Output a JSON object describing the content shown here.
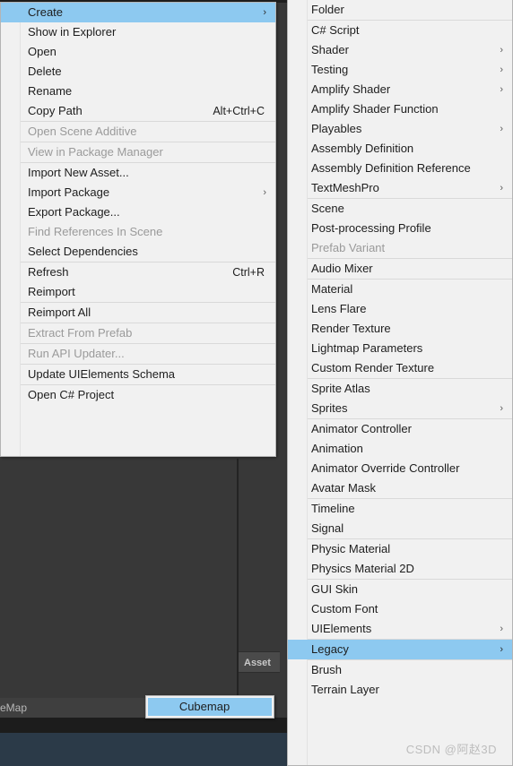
{
  "colors": {
    "menu_background": "#f1f1f1",
    "menu_border": "#b4b4b4",
    "highlight": "#8dc9f0",
    "text": "#1d1d1d",
    "text_disabled": "#9a9a9a",
    "separator": "#d9d9d9",
    "editor_dark": "#383838",
    "editor_darker": "#1c1c1c",
    "scene_blue": "#2b3a48"
  },
  "editor": {
    "project_row_label": "eMap",
    "inspector_asset_label": "Asset"
  },
  "context_menu": {
    "name": "asset-context-menu",
    "items": [
      {
        "label": "Create",
        "shortcut": "",
        "arrow": true,
        "disabled": false,
        "selected": true,
        "sep_after": false
      },
      {
        "label": "Show in Explorer",
        "shortcut": "",
        "arrow": false,
        "disabled": false,
        "selected": false,
        "sep_after": false
      },
      {
        "label": "Open",
        "shortcut": "",
        "arrow": false,
        "disabled": false,
        "selected": false,
        "sep_after": false
      },
      {
        "label": "Delete",
        "shortcut": "",
        "arrow": false,
        "disabled": false,
        "selected": false,
        "sep_after": false
      },
      {
        "label": "Rename",
        "shortcut": "",
        "arrow": false,
        "disabled": false,
        "selected": false,
        "sep_after": false
      },
      {
        "label": "Copy Path",
        "shortcut": "Alt+Ctrl+C",
        "arrow": false,
        "disabled": false,
        "selected": false,
        "sep_after": true
      },
      {
        "label": "Open Scene Additive",
        "shortcut": "",
        "arrow": false,
        "disabled": true,
        "selected": false,
        "sep_after": true
      },
      {
        "label": "View in Package Manager",
        "shortcut": "",
        "arrow": false,
        "disabled": true,
        "selected": false,
        "sep_after": true
      },
      {
        "label": "Import New Asset...",
        "shortcut": "",
        "arrow": false,
        "disabled": false,
        "selected": false,
        "sep_after": false
      },
      {
        "label": "Import Package",
        "shortcut": "",
        "arrow": true,
        "disabled": false,
        "selected": false,
        "sep_after": false
      },
      {
        "label": "Export Package...",
        "shortcut": "",
        "arrow": false,
        "disabled": false,
        "selected": false,
        "sep_after": false
      },
      {
        "label": "Find References In Scene",
        "shortcut": "",
        "arrow": false,
        "disabled": true,
        "selected": false,
        "sep_after": false
      },
      {
        "label": "Select Dependencies",
        "shortcut": "",
        "arrow": false,
        "disabled": false,
        "selected": false,
        "sep_after": true
      },
      {
        "label": "Refresh",
        "shortcut": "Ctrl+R",
        "arrow": false,
        "disabled": false,
        "selected": false,
        "sep_after": false
      },
      {
        "label": "Reimport",
        "shortcut": "",
        "arrow": false,
        "disabled": false,
        "selected": false,
        "sep_after": true
      },
      {
        "label": "Reimport All",
        "shortcut": "",
        "arrow": false,
        "disabled": false,
        "selected": false,
        "sep_after": true
      },
      {
        "label": "Extract From Prefab",
        "shortcut": "",
        "arrow": false,
        "disabled": true,
        "selected": false,
        "sep_after": true
      },
      {
        "label": "Run API Updater...",
        "shortcut": "",
        "arrow": false,
        "disabled": true,
        "selected": false,
        "sep_after": true
      },
      {
        "label": "Update UIElements Schema",
        "shortcut": "",
        "arrow": false,
        "disabled": false,
        "selected": false,
        "sep_after": true
      },
      {
        "label": "Open C# Project",
        "shortcut": "",
        "arrow": false,
        "disabled": false,
        "selected": false,
        "sep_after": false
      }
    ]
  },
  "create_menu": {
    "name": "create-submenu",
    "items": [
      {
        "label": "Folder",
        "arrow": false,
        "disabled": false,
        "selected": false,
        "sep_after": true
      },
      {
        "label": "C# Script",
        "arrow": false,
        "disabled": false,
        "selected": false,
        "sep_after": false
      },
      {
        "label": "Shader",
        "arrow": true,
        "disabled": false,
        "selected": false,
        "sep_after": false
      },
      {
        "label": "Testing",
        "arrow": true,
        "disabled": false,
        "selected": false,
        "sep_after": false
      },
      {
        "label": "Amplify Shader",
        "arrow": true,
        "disabled": false,
        "selected": false,
        "sep_after": false
      },
      {
        "label": "Amplify Shader Function",
        "arrow": false,
        "disabled": false,
        "selected": false,
        "sep_after": false
      },
      {
        "label": "Playables",
        "arrow": true,
        "disabled": false,
        "selected": false,
        "sep_after": false
      },
      {
        "label": "Assembly Definition",
        "arrow": false,
        "disabled": false,
        "selected": false,
        "sep_after": false
      },
      {
        "label": "Assembly Definition Reference",
        "arrow": false,
        "disabled": false,
        "selected": false,
        "sep_after": false
      },
      {
        "label": "TextMeshPro",
        "arrow": true,
        "disabled": false,
        "selected": false,
        "sep_after": true
      },
      {
        "label": "Scene",
        "arrow": false,
        "disabled": false,
        "selected": false,
        "sep_after": false
      },
      {
        "label": "Post-processing Profile",
        "arrow": false,
        "disabled": false,
        "selected": false,
        "sep_after": false
      },
      {
        "label": "Prefab Variant",
        "arrow": false,
        "disabled": true,
        "selected": false,
        "sep_after": true
      },
      {
        "label": "Audio Mixer",
        "arrow": false,
        "disabled": false,
        "selected": false,
        "sep_after": true
      },
      {
        "label": "Material",
        "arrow": false,
        "disabled": false,
        "selected": false,
        "sep_after": false
      },
      {
        "label": "Lens Flare",
        "arrow": false,
        "disabled": false,
        "selected": false,
        "sep_after": false
      },
      {
        "label": "Render Texture",
        "arrow": false,
        "disabled": false,
        "selected": false,
        "sep_after": false
      },
      {
        "label": "Lightmap Parameters",
        "arrow": false,
        "disabled": false,
        "selected": false,
        "sep_after": false
      },
      {
        "label": "Custom Render Texture",
        "arrow": false,
        "disabled": false,
        "selected": false,
        "sep_after": true
      },
      {
        "label": "Sprite Atlas",
        "arrow": false,
        "disabled": false,
        "selected": false,
        "sep_after": false
      },
      {
        "label": "Sprites",
        "arrow": true,
        "disabled": false,
        "selected": false,
        "sep_after": true
      },
      {
        "label": "Animator Controller",
        "arrow": false,
        "disabled": false,
        "selected": false,
        "sep_after": false
      },
      {
        "label": "Animation",
        "arrow": false,
        "disabled": false,
        "selected": false,
        "sep_after": false
      },
      {
        "label": "Animator Override Controller",
        "arrow": false,
        "disabled": false,
        "selected": false,
        "sep_after": false
      },
      {
        "label": "Avatar Mask",
        "arrow": false,
        "disabled": false,
        "selected": false,
        "sep_after": true
      },
      {
        "label": "Timeline",
        "arrow": false,
        "disabled": false,
        "selected": false,
        "sep_after": false
      },
      {
        "label": "Signal",
        "arrow": false,
        "disabled": false,
        "selected": false,
        "sep_after": true
      },
      {
        "label": "Physic Material",
        "arrow": false,
        "disabled": false,
        "selected": false,
        "sep_after": false
      },
      {
        "label": "Physics Material 2D",
        "arrow": false,
        "disabled": false,
        "selected": false,
        "sep_after": true
      },
      {
        "label": "GUI Skin",
        "arrow": false,
        "disabled": false,
        "selected": false,
        "sep_after": false
      },
      {
        "label": "Custom Font",
        "arrow": false,
        "disabled": false,
        "selected": false,
        "sep_after": false
      },
      {
        "label": "UIElements",
        "arrow": true,
        "disabled": false,
        "selected": false,
        "sep_after": true
      },
      {
        "label": "Legacy",
        "arrow": true,
        "disabled": false,
        "selected": true,
        "sep_after": true
      },
      {
        "label": "Brush",
        "arrow": false,
        "disabled": false,
        "selected": false,
        "sep_after": false
      },
      {
        "label": "Terrain Layer",
        "arrow": false,
        "disabled": false,
        "selected": false,
        "sep_after": false
      }
    ]
  },
  "legacy_menu": {
    "name": "legacy-submenu",
    "items": [
      {
        "label": "Cubemap",
        "arrow": false,
        "disabled": false,
        "selected": true,
        "sep_after": false
      }
    ]
  },
  "watermark": {
    "text": "CSDN @阿赵3D"
  }
}
